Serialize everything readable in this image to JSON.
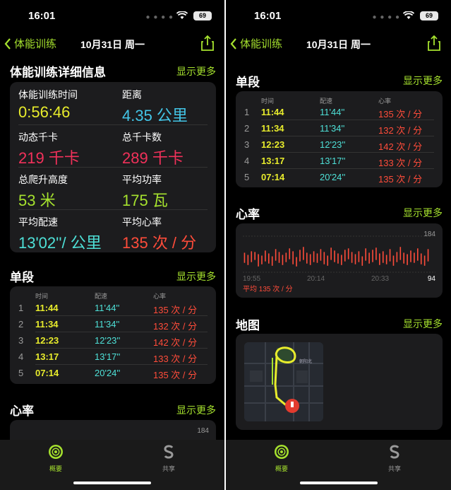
{
  "status": {
    "time": "16:01",
    "battery": "69"
  },
  "nav": {
    "back_label": "体能训练",
    "title": "10月31日 周一"
  },
  "details": {
    "heading": "体能训练详细信息",
    "more": "显示更多",
    "metrics": [
      {
        "label": "体能训练时间",
        "value": "0:56:46",
        "color": "#e8ec2c"
      },
      {
        "label": "距离",
        "value": "4.35 公里",
        "color": "#43c6e8"
      },
      {
        "label": "动态千卡",
        "value": "219 千卡",
        "color": "#f2315a"
      },
      {
        "label": "总千卡数",
        "value": "289 千卡",
        "color": "#f2315a"
      },
      {
        "label": "总爬升高度",
        "value": "53 米",
        "color": "#a6e22e"
      },
      {
        "label": "平均功率",
        "value": "175 瓦",
        "color": "#a6e22e"
      },
      {
        "label": "平均配速",
        "value": "13'02''/ 公里",
        "color": "#4ee0d7"
      },
      {
        "label": "平均心率",
        "value": "135 次 / 分",
        "color": "#ff4c3a"
      }
    ]
  },
  "splits": {
    "heading": "单段",
    "more": "显示更多",
    "columns": [
      "时间",
      "配速",
      "心率"
    ],
    "rows": [
      {
        "index": "1",
        "time": "11:44",
        "pace": "11'44''",
        "hr": "135 次 / 分"
      },
      {
        "index": "2",
        "time": "11:34",
        "pace": "11'34''",
        "hr": "132 次 / 分"
      },
      {
        "index": "3",
        "time": "12:23",
        "pace": "12'23''",
        "hr": "142 次 / 分"
      },
      {
        "index": "4",
        "time": "13:17",
        "pace": "13'17''",
        "hr": "133 次 / 分"
      },
      {
        "index": "5",
        "time": "07:14",
        "pace": "20'24''",
        "hr": "135 次 / 分"
      }
    ]
  },
  "heart_rate": {
    "heading": "心率",
    "more": "显示更多",
    "max_label": "184",
    "min_label": "94",
    "x_labels": [
      "19:55",
      "20:14",
      "20:33"
    ],
    "avg_label": "平均 135 次 / 分"
  },
  "chart_data": {
    "type": "bar",
    "title": "",
    "xlabel": "",
    "ylabel": "",
    "ylim": [
      94,
      184
    ],
    "x_ticks": [
      "19:55",
      "20:14",
      "20:33"
    ],
    "series": [
      {
        "values": [
          [
            118,
            146
          ],
          [
            112,
            140
          ],
          [
            120,
            150
          ],
          [
            126,
            148
          ],
          [
            108,
            142
          ],
          [
            114,
            138
          ],
          [
            122,
            152
          ],
          [
            116,
            144
          ],
          [
            110,
            136
          ],
          [
            124,
            156
          ],
          [
            118,
            148
          ],
          [
            112,
            140
          ],
          [
            120,
            146
          ],
          [
            128,
            158
          ],
          [
            114,
            150
          ],
          [
            108,
            134
          ],
          [
            122,
            154
          ],
          [
            126,
            162
          ],
          [
            116,
            146
          ],
          [
            112,
            142
          ],
          [
            120,
            150
          ],
          [
            118,
            144
          ],
          [
            124,
            156
          ],
          [
            114,
            148
          ],
          [
            110,
            138
          ],
          [
            126,
            160
          ],
          [
            120,
            152
          ],
          [
            116,
            144
          ],
          [
            112,
            140
          ],
          [
            122,
            154
          ],
          [
            128,
            158
          ],
          [
            118,
            148
          ],
          [
            114,
            142
          ],
          [
            120,
            150
          ],
          [
            110,
            136
          ],
          [
            124,
            158
          ],
          [
            116,
            146
          ],
          [
            120,
            154
          ],
          [
            126,
            160
          ],
          [
            112,
            144
          ],
          [
            118,
            150
          ],
          [
            114,
            140
          ],
          [
            122,
            156
          ],
          [
            110,
            138
          ],
          [
            120,
            148
          ],
          [
            126,
            162
          ],
          [
            116,
            146
          ],
          [
            112,
            142
          ],
          [
            120,
            152
          ],
          [
            118,
            146
          ],
          [
            124,
            158
          ],
          [
            114,
            144
          ],
          [
            110,
            138
          ],
          [
            122,
            156
          ]
        ]
      }
    ]
  },
  "map": {
    "heading": "地图",
    "more": "显示更多",
    "road_label": "朝阳北"
  },
  "tabbar": {
    "summary_label": "概要",
    "share_label": "共享"
  }
}
